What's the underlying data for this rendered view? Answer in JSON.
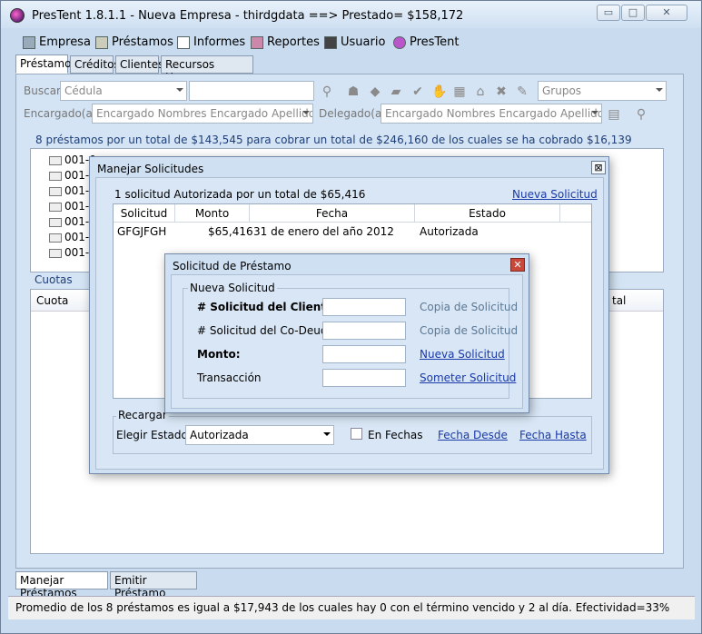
{
  "window": {
    "title": "PresTent 1.8.1.1 - Nueva Empresa - thirdgdata ==> Prestado= $158,172",
    "minimize": "▭",
    "maximize": "□",
    "close": "✕"
  },
  "menu": [
    {
      "label": "Empresa",
      "icon": "building-icon"
    },
    {
      "label": "Préstamos",
      "icon": "money-icon"
    },
    {
      "label": "Informes",
      "icon": "chart-icon"
    },
    {
      "label": "Reportes",
      "icon": "report-icon"
    },
    {
      "label": "Usuario",
      "icon": "user-icon"
    },
    {
      "label": "PresTent",
      "icon": "app-icon"
    }
  ],
  "tabs": [
    "Préstamos",
    "Créditos",
    "Clientes",
    "Recursos Humanos"
  ],
  "filters": {
    "buscar_label": "Buscar",
    "buscar_combo": "Cédula",
    "grupos_combo": "Grupos",
    "encargado_label": "Encargado(a)",
    "encargado_combo": "Encargado Nombres Encargado Apellidos",
    "delegado_label": "Delegado(a)",
    "delegado_combo": "Encargado Nombres Encargado Apellidos"
  },
  "summary": "8 préstamos por un total de $143,545 para cobrar un total de $246,160 de los cuales se ha cobrado $16,139",
  "loans": [
    "001-0",
    "001-0",
    "001-0",
    "001-0",
    "001-0",
    "001-0",
    "001-0"
  ],
  "cuotas": {
    "label": "Cuotas",
    "col_cuota": "Cuota",
    "col_tal": "tal"
  },
  "bottom_tabs": [
    "Manejar  Préstamos",
    "Emitir Préstamo"
  ],
  "status": "Promedio de los 8 préstamos es igual a $17,943 de los cuales hay 0 con el término vencido y 2 al día.  Efectividad=33%",
  "manejar": {
    "title": "Manejar Solicitudes",
    "close": "⊠",
    "summary": "1 solicitud Autorizada por un total de $65,416",
    "nueva_link": "Nueva Solicitud",
    "headers": [
      "Solicitud",
      "Monto",
      "Fecha",
      "Estado"
    ],
    "rows": [
      {
        "solicitud": "GFGJFGH",
        "monto": "$65,416",
        "fecha": "31 de enero del año 2012",
        "estado": "Autorizada"
      }
    ],
    "recargar": "Recargar",
    "elegir_label": "Elegir Estado:",
    "estado_combo": "Autorizada",
    "en_fechas": "En Fechas",
    "fecha_desde": "Fecha Desde",
    "fecha_hasta": "Fecha Hasta"
  },
  "prestamo": {
    "title": "Solicitud de Préstamo",
    "close": "✕",
    "group": "Nueva Solicitud",
    "cliente_label": "# Solicitud del Cliente:",
    "codeudor_label": "# Solicitud del Co-Deudor:",
    "monto_label": "Monto:",
    "transaccion_label": "Transacción",
    "copia1": "Copia de Solicitud",
    "copia2": "Copia de Solicitud",
    "nueva_link": "Nueva Solicitud",
    "someter_link": "Someter Solicitud"
  }
}
